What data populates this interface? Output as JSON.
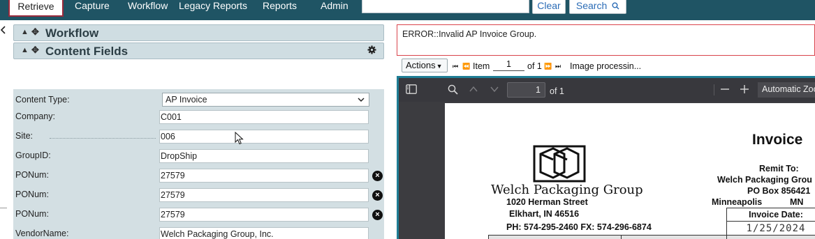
{
  "nav": {
    "tabs": [
      "Retrieve",
      "Capture",
      "Workflow",
      "Legacy Reports",
      "Reports",
      "Admin"
    ],
    "search_value": "",
    "clear_label": "Clear",
    "search_label": "Search"
  },
  "panels": {
    "workflow_title": "Workflow",
    "content_fields_title": "Content Fields"
  },
  "fields": {
    "content_type_label": "Content Type:",
    "content_type_value": "AP Invoice",
    "rows": [
      {
        "label": "Company:",
        "value": "C001"
      },
      {
        "label": "Site:",
        "value": "006"
      },
      {
        "label": "GroupID:",
        "value": "DropShip"
      },
      {
        "label": "PONum:",
        "value": "27579"
      },
      {
        "label": "PONum:",
        "value": "27579"
      },
      {
        "label": "PONum:",
        "value": "27579"
      },
      {
        "label": "VendorName:",
        "value": "Welch Packaging Group, Inc."
      }
    ]
  },
  "error": {
    "message": "ERROR::Invalid AP Invoice Group."
  },
  "actions_bar": {
    "actions_label": "Actions",
    "item_label": "Item",
    "item_value": "1",
    "of_label": "of 1",
    "status_text": "Image processin..."
  },
  "viewer": {
    "page_value": "1",
    "page_of": "of 1",
    "zoom_label": "Automatic Zoom"
  },
  "document": {
    "company_name": "Welch Packaging Group",
    "address_line1": "1020 Herman Street",
    "address_line2": "Elkhart, IN  46516",
    "phone_line": "PH: 574-295-2460 FX: 574-296-6874",
    "title": "Invoice",
    "remit_to_label": "Remit To:",
    "remit_name": "Welch Packaging Grou",
    "remit_po": "PO Box 856421",
    "remit_city": "Minneapolis",
    "remit_state": "MN",
    "invoice_date_label": "Invoice Date:",
    "invoice_date_value": "1/25/2024"
  },
  "colors": {
    "nav_bg": "#1f5464",
    "active_tab_border": "#9a2a3c",
    "panel_bg": "#cfdde2",
    "fields_bg": "#d3dfe3",
    "error_border": "#d9434b",
    "viewer_bg": "#38383d",
    "viewer_accent": "#1f7e95",
    "link_blue": "#2b6cb6"
  }
}
